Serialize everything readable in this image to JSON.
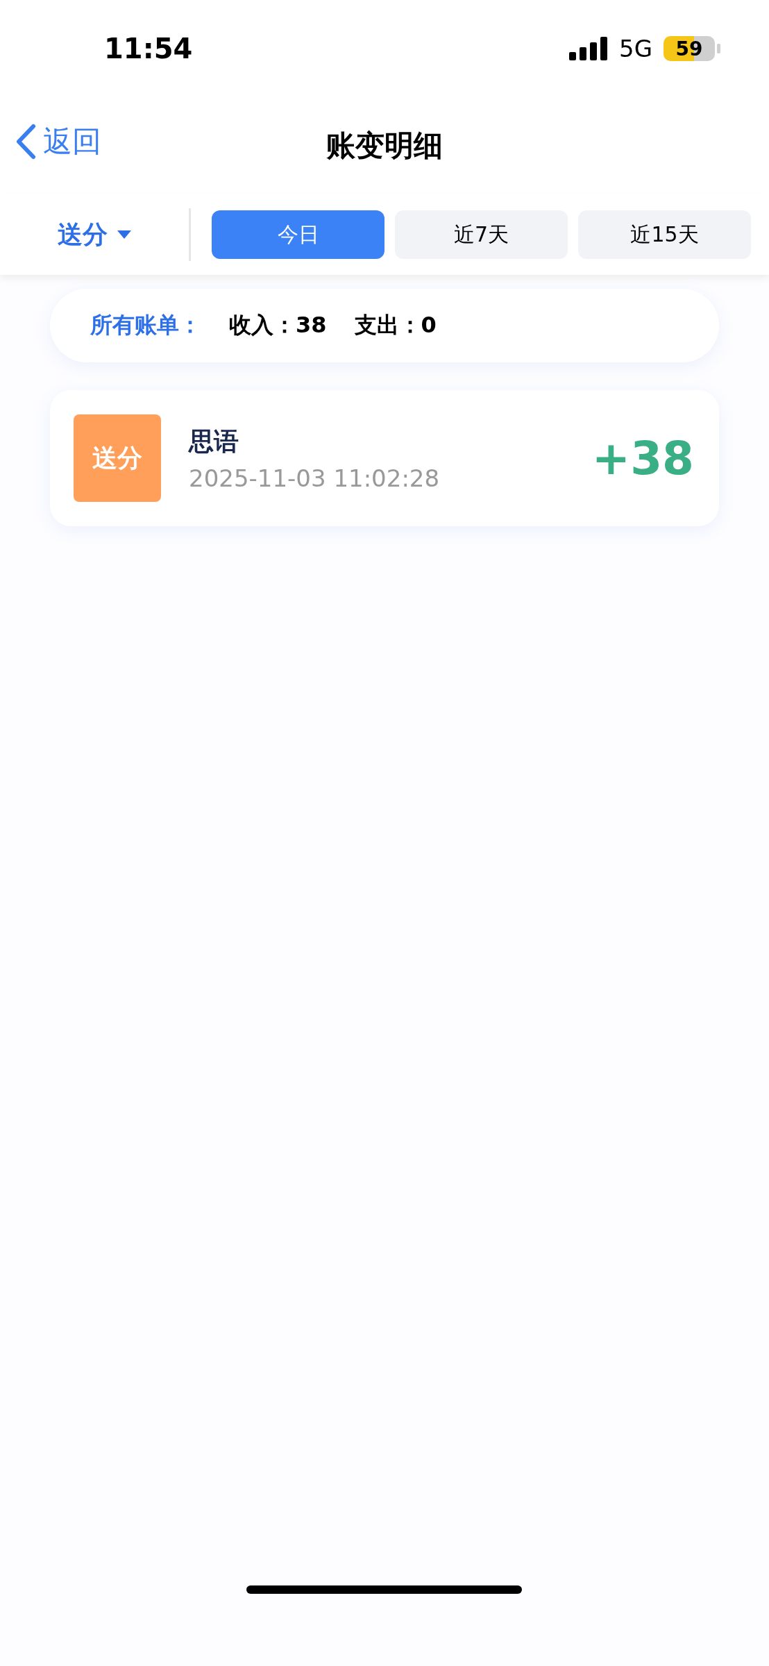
{
  "status_bar": {
    "time": "11:54",
    "network": "5G",
    "battery": "59"
  },
  "nav": {
    "back": "返回",
    "title": "账变明细"
  },
  "filter": {
    "dropdown": "送分",
    "tabs": [
      {
        "label": "今日",
        "selected": true
      },
      {
        "label": "近7天",
        "selected": false
      },
      {
        "label": "近15天",
        "selected": false
      }
    ]
  },
  "summary": {
    "label": "所有账单：",
    "income": "收入：38",
    "expense": "支出：0"
  },
  "records": [
    {
      "badge": "送分",
      "name": "思语",
      "time": "2025-11-03 11:02:28",
      "amount": "+38"
    }
  ]
}
